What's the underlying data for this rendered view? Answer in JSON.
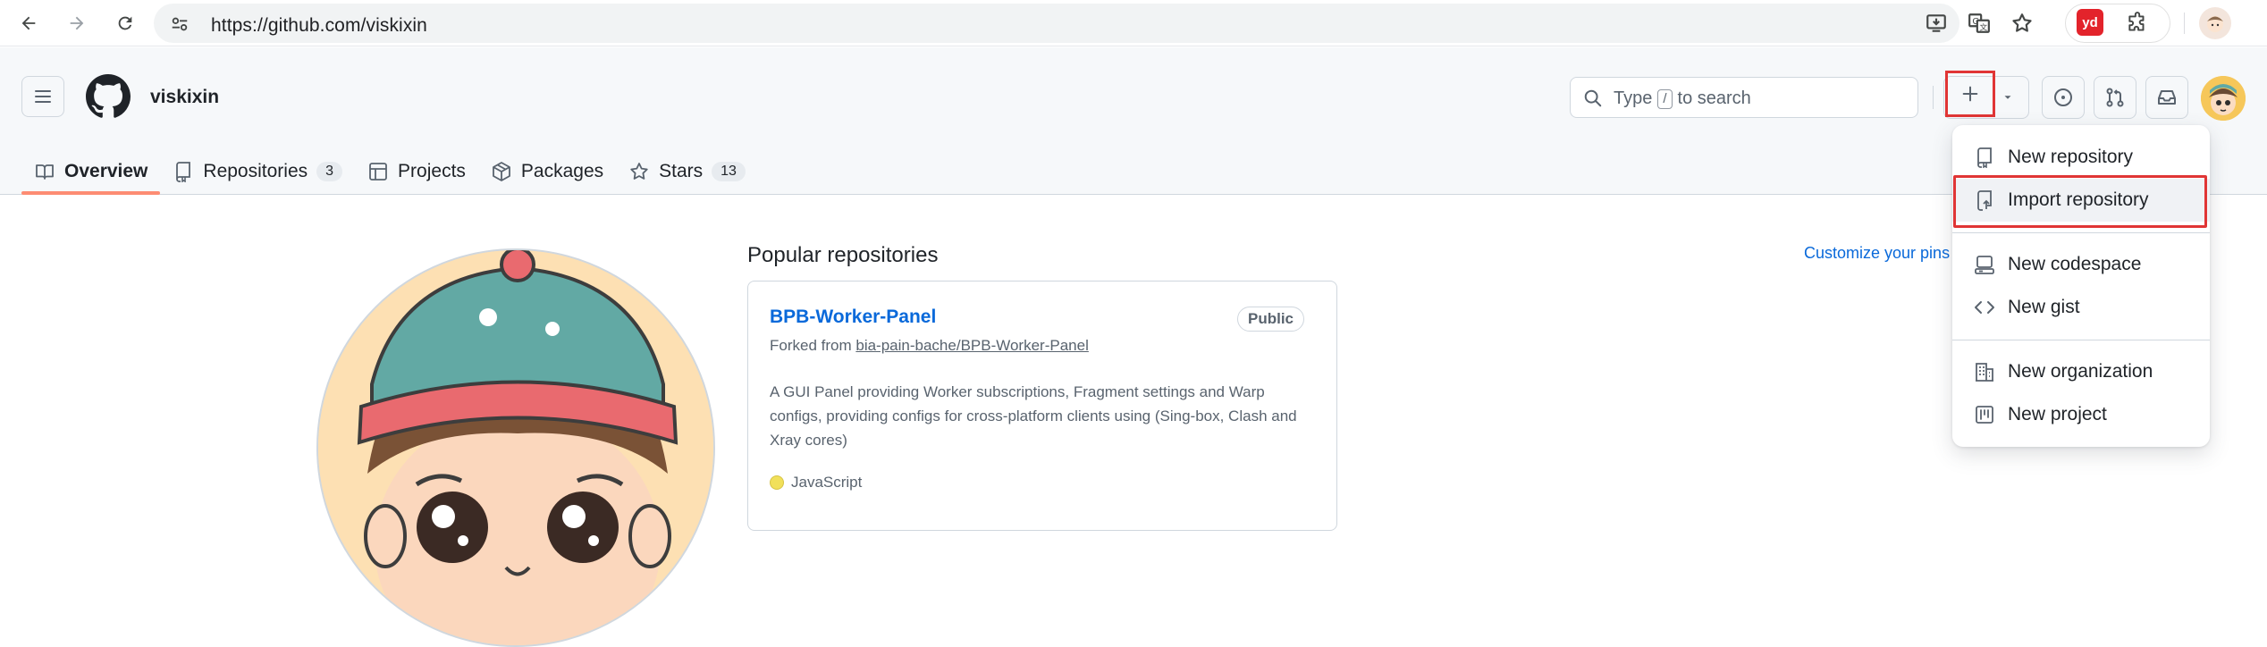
{
  "browser": {
    "url": "https://github.com/viskixin",
    "extension_badge": "yd"
  },
  "header": {
    "username": "viskixin",
    "search": {
      "prefix": "Type",
      "key": "/",
      "suffix": "to search"
    }
  },
  "tabs": [
    {
      "label": "Overview",
      "icon": "book-icon",
      "active": true
    },
    {
      "label": "Repositories",
      "icon": "repo-icon",
      "count": "3"
    },
    {
      "label": "Projects",
      "icon": "table-icon"
    },
    {
      "label": "Packages",
      "icon": "package-icon"
    },
    {
      "label": "Stars",
      "icon": "star-icon",
      "count": "13"
    }
  ],
  "main": {
    "popular_title": "Popular repositories",
    "customize_link": "Customize your pins",
    "repo": {
      "name": "BPB-Worker-Panel",
      "visibility": "Public",
      "forked_prefix": "Forked from",
      "forked_source": "bia-pain-bache/BPB-Worker-Panel",
      "description": "A GUI Panel providing Worker subscriptions, Fragment settings and Warp configs, providing configs for cross-platform clients using (Sing-box, Clash and Xray cores)",
      "language": "JavaScript",
      "language_color": "#f1e05a"
    }
  },
  "create_menu": {
    "items": [
      {
        "label": "New repository",
        "icon": "repo-icon"
      },
      {
        "label": "Import repository",
        "icon": "repo-push-icon",
        "highlighted": true
      },
      {
        "label": "New codespace",
        "icon": "codespaces-icon"
      },
      {
        "label": "New gist",
        "icon": "code-icon"
      },
      {
        "label": "New organization",
        "icon": "organization-icon"
      },
      {
        "label": "New project",
        "icon": "project-icon"
      }
    ]
  },
  "colors": {
    "accent_link": "#0969da",
    "tab_underline": "#fd8c73",
    "highlight_box": "#e03535"
  }
}
